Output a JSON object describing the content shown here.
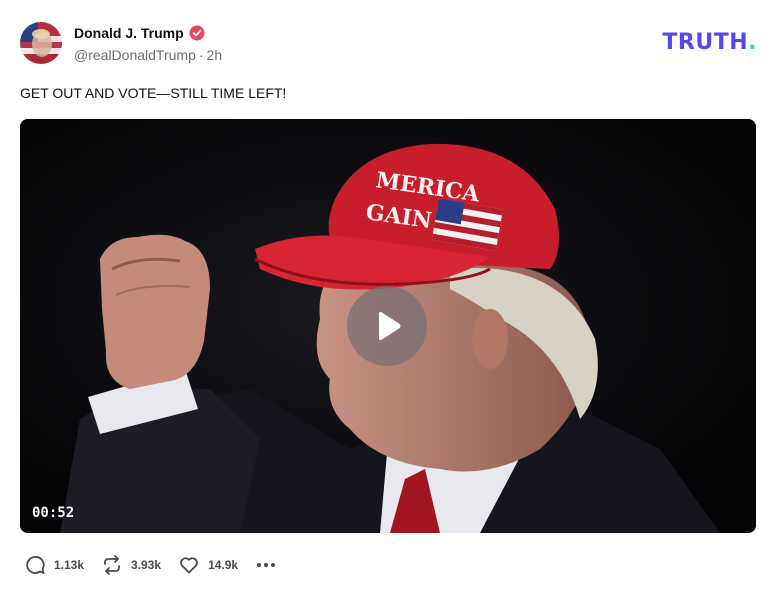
{
  "post": {
    "author_name": "Donald J. Trump",
    "handle": "@realDonaldTrump",
    "separator": "·",
    "time_ago": "2h",
    "text": "GET OUT AND VOTE—STILL TIME LEFT!"
  },
  "brand": {
    "logo_text": "TRUTH",
    "logo_dot": "."
  },
  "video": {
    "duration": "00:52",
    "play_icon": "play-icon",
    "hat_text_line1": "MERICA",
    "hat_text_line2": "GAIN"
  },
  "actions": {
    "replies": "1.13k",
    "retruths": "3.93k",
    "likes": "14.9k",
    "more_icon": "more-horizontal-icon"
  },
  "colors": {
    "brand_purple": "#5448ee",
    "brand_teal": "#17e3b9",
    "verified_red": "#e8485f"
  }
}
